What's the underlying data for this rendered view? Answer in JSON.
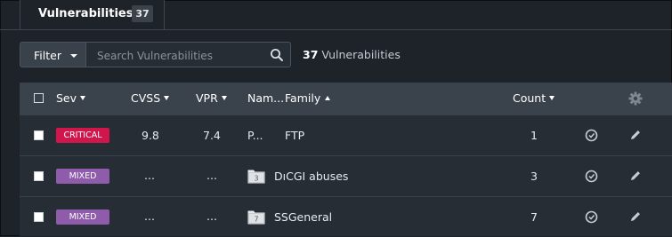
{
  "tab": {
    "label": "Vulnerabilities",
    "badge": "37"
  },
  "filter": {
    "button_label": "Filter",
    "search_placeholder": "Search Vulnerabilities",
    "search_value": ""
  },
  "summary": {
    "count": "37",
    "label": "Vulnerabilities"
  },
  "table": {
    "columns": {
      "sev": "Sev",
      "cvss": "CVSS",
      "vpr": "VPR",
      "name": "Nam...",
      "family": "Family",
      "count": "Count"
    },
    "sort": {
      "family": "ascending"
    },
    "rows": [
      {
        "severity": "CRITICAL",
        "severity_color": "#d1164b",
        "cvss": "9.8",
        "vpr": "7.4",
        "name": "P...",
        "folder_count": "",
        "family": "FTP",
        "count": "1"
      },
      {
        "severity": "MIXED",
        "severity_color": "#8e5cab",
        "cvss": "...",
        "vpr": "...",
        "name": "",
        "folder_count": "3",
        "family": "DıCGI abuses",
        "count": "3"
      },
      {
        "severity": "MIXED",
        "severity_color": "#8e5cab",
        "cvss": "...",
        "vpr": "...",
        "name": "",
        "folder_count": "7",
        "family": "SSGeneral",
        "count": "7"
      }
    ]
  },
  "icons": {
    "search": "search-icon",
    "settings": "gear-icon",
    "snooze": "clock-check-icon",
    "edit": "pencil-icon",
    "folder": "folder-icon"
  },
  "colors": {
    "background": "#1d2329",
    "header_bg": "#3a434c",
    "row_bg": "#262d34",
    "critical": "#d1164b",
    "mixed": "#8e5cab"
  }
}
